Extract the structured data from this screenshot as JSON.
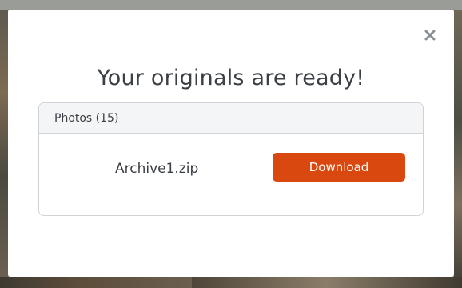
{
  "modal": {
    "title": "Your originals are ready!",
    "close_icon": "close-icon"
  },
  "archive_card": {
    "header": "Photos (15)",
    "file_name": "Archive1.zip",
    "download_label": "Download"
  },
  "colors": {
    "accent": "#d9480f",
    "text": "#3b4046",
    "border": "#cfd3d7",
    "header_bg": "#f4f5f7"
  }
}
